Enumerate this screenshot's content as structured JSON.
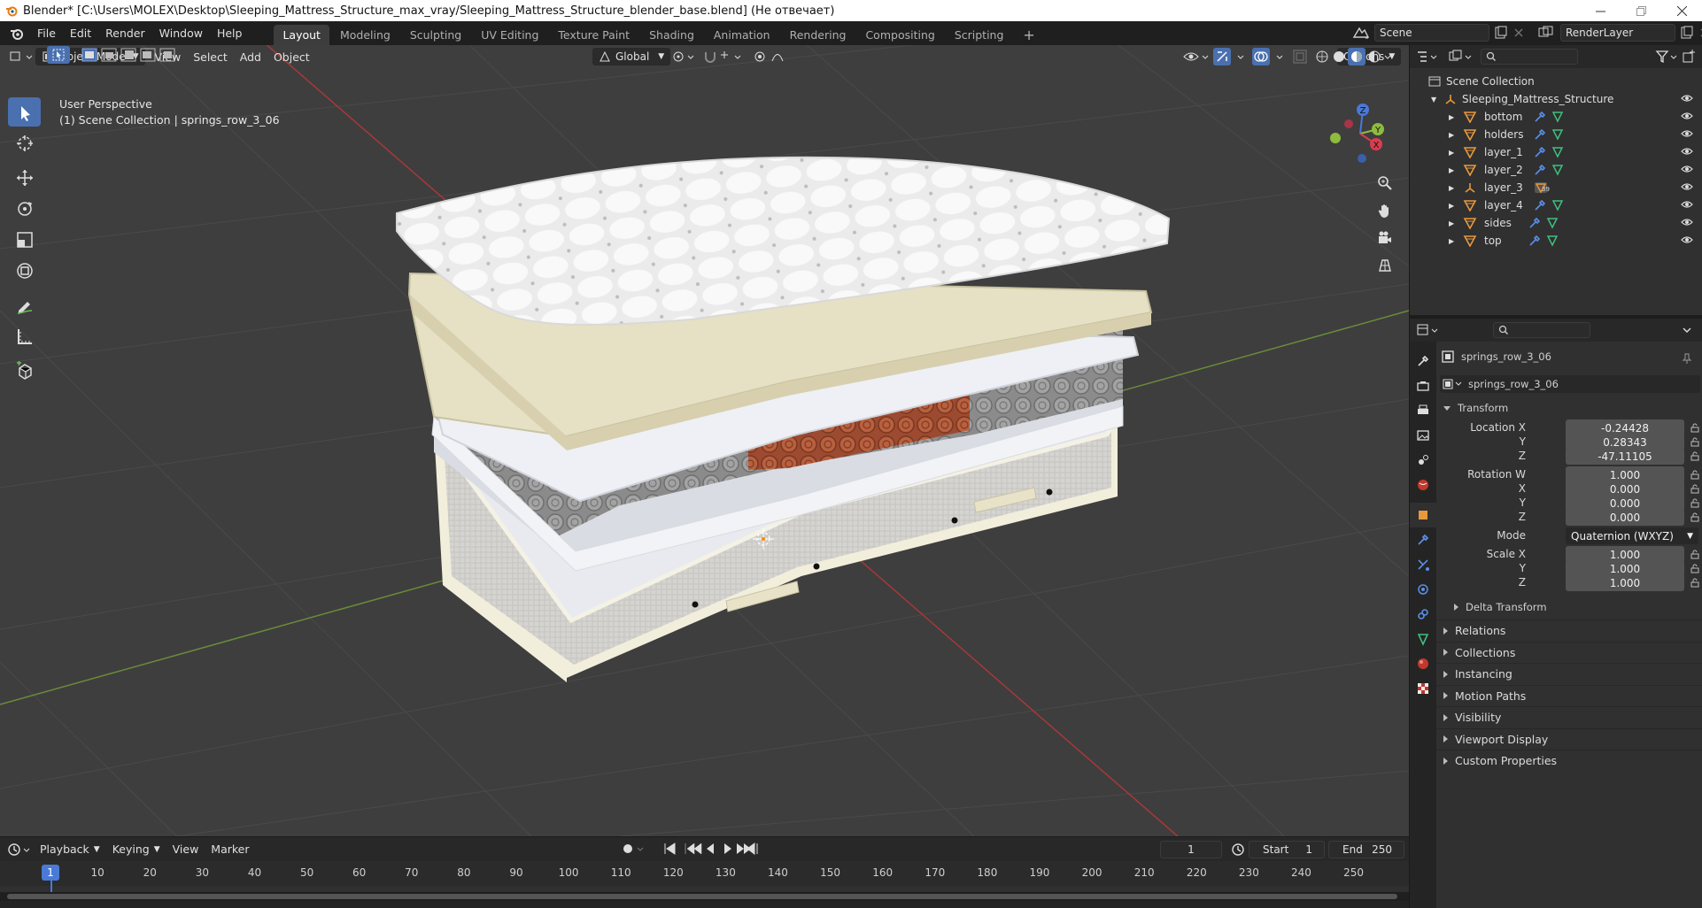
{
  "window": {
    "title": "Blender* [C:\\Users\\MOLEX\\Desktop\\Sleeping_Mattress_Structure_max_vray/Sleeping_Mattress_Structure_blender_base.blend] (Не отвечает)"
  },
  "menu": [
    "File",
    "Edit",
    "Render",
    "Window",
    "Help"
  ],
  "workspaces": [
    "Layout",
    "Modeling",
    "Sculpting",
    "UV Editing",
    "Texture Paint",
    "Shading",
    "Animation",
    "Rendering",
    "Compositing",
    "Scripting"
  ],
  "active_workspace": "Layout",
  "scene": {
    "name": "Scene",
    "render_layer": "RenderLayer"
  },
  "viewport": {
    "mode": "Object Mode",
    "menus": [
      "View",
      "Select",
      "Add",
      "Object"
    ],
    "orientation": "Global",
    "options_label": "Options",
    "perspective": "User Perspective",
    "collection_info": "(1) Scene Collection | springs_row_3_06",
    "gizmo": {
      "x": "X",
      "y": "Y",
      "z": "Z"
    }
  },
  "outliner": {
    "root": "Scene Collection",
    "parent": "Sleeping_Mattress_Structure",
    "items": [
      "bottom",
      "holders",
      "layer_1",
      "layer_2",
      "layer_3",
      "layer_4",
      "sides",
      "top"
    ],
    "badge": "39"
  },
  "properties": {
    "object_name": "springs_row_3_06",
    "datablock": "springs_row_3_06",
    "transform_title": "Transform",
    "location": {
      "label": "Location X",
      "x": "-0.24428",
      "y": "0.28343",
      "z": "-47.11105"
    },
    "rotation": {
      "label": "Rotation W",
      "w": "1.000",
      "x": "0.000",
      "y": "0.000",
      "z": "0.000"
    },
    "mode_label": "Mode",
    "mode_value": "Quaternion (WXYZ)",
    "scale": {
      "label": "Scale X",
      "x": "1.000",
      "y": "1.000",
      "z": "1.000"
    },
    "axis_labels": {
      "y": "Y",
      "z": "Z",
      "x": "X"
    },
    "delta": "Delta Transform",
    "panels": [
      "Relations",
      "Collections",
      "Instancing",
      "Motion Paths",
      "Visibility",
      "Viewport Display",
      "Custom Properties"
    ]
  },
  "timeline": {
    "menus": [
      "Playback",
      "Keying",
      "View",
      "Marker"
    ],
    "current_frame": "1",
    "start_label": "Start",
    "start": "1",
    "end_label": "End",
    "end": "250",
    "ticks": [
      "10",
      "20",
      "30",
      "40",
      "50",
      "60",
      "70",
      "80",
      "90",
      "100",
      "110",
      "120",
      "130",
      "140",
      "150",
      "160",
      "170",
      "180",
      "190",
      "200",
      "210",
      "220",
      "230",
      "240",
      "250"
    ],
    "playhead": "1"
  }
}
